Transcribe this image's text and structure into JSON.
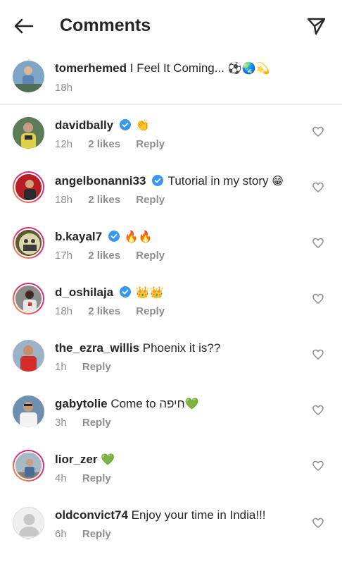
{
  "header": {
    "back_icon": "arrow-left-icon",
    "title": "Comments",
    "send_icon": "paper-plane-icon"
  },
  "caption": {
    "username": "tomerhemed",
    "text": "I Feel It Coming...",
    "emoji": "⚽🌏💫",
    "time": "18h"
  },
  "comments": [
    {
      "username": "davidbally",
      "verified": true,
      "text": "",
      "emoji": "👏",
      "time": "12h",
      "likes": "2 likes",
      "reply": "Reply"
    },
    {
      "username": "angelbonanni33",
      "verified": true,
      "text": "Tutorial in my story",
      "emoji": "😁",
      "time": "18h",
      "likes": "2 likes",
      "reply": "Reply"
    },
    {
      "username": "b.kayal7",
      "verified": true,
      "text": "",
      "emoji": "🔥🔥",
      "time": "17h",
      "likes": "2 likes",
      "reply": "Reply"
    },
    {
      "username": "d_oshilaja",
      "verified": true,
      "text": "",
      "emoji": "👑👑",
      "time": "18h",
      "likes": "2 likes",
      "reply": "Reply"
    },
    {
      "username": "the_ezra_willis",
      "verified": false,
      "text": "Phoenix it is??",
      "emoji": "",
      "time": "1h",
      "likes": "",
      "reply": "Reply"
    },
    {
      "username": "gabytolie",
      "verified": false,
      "text": "Come to חיפה",
      "emoji": "💚",
      "time": "3h",
      "likes": "",
      "reply": "Reply"
    },
    {
      "username": "lior_zer",
      "verified": false,
      "text": "",
      "emoji": "💚",
      "time": "4h",
      "likes": "",
      "reply": "Reply"
    },
    {
      "username": "oldconvict74",
      "verified": false,
      "text": "Enjoy your time in India!!!",
      "emoji": "",
      "time": "6h",
      "likes": "",
      "reply": "Reply"
    }
  ],
  "colors": {
    "text": "#262626",
    "secondary": "#8e8e8e",
    "verified": "#3897f0",
    "story_ring": "#e1306c"
  }
}
